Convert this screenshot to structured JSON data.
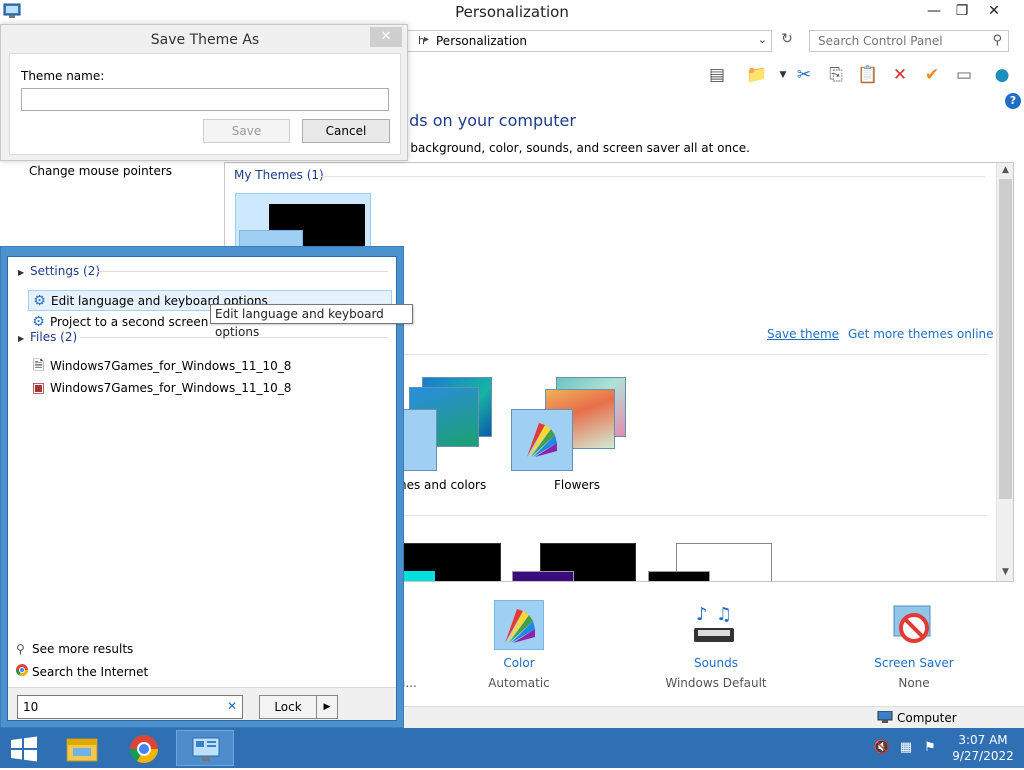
{
  "window": {
    "title": "Personalization",
    "address_path": "Personalization",
    "search_placeholder": "Search Control Panel",
    "heading": "nds on your computer",
    "subheading": "p background, color, sounds, and screen saver all at once.",
    "left_link": "Change mouse pointers"
  },
  "themes": {
    "my_themes_header": "My Themes (1)",
    "save_theme": "Save theme",
    "more_themes": "Get more themes online",
    "lines_label": "nes and colors",
    "flowers_label": "Flowers"
  },
  "bottom": {
    "color_label": "Color",
    "color_value": "Automatic",
    "sounds_label": "Sounds",
    "sounds_value": "Windows Default",
    "saver_label": "Screen Saver",
    "saver_value": "None",
    "desktop_truncated": "a..."
  },
  "status": {
    "computer_label": "Computer"
  },
  "dialog": {
    "title": "Save Theme As",
    "theme_name_label": "Theme name:",
    "theme_name_value": "",
    "save_label": "Save",
    "cancel_label": "Cancel"
  },
  "search_panel": {
    "settings_header": "Settings (2)",
    "results_settings": [
      "Edit language and keyboard options",
      "Project to a second screen"
    ],
    "files_header": "Files (2)",
    "results_files": [
      "Windows7Games_for_Windows_11_10_8",
      "Windows7Games_for_Windows_11_10_8"
    ],
    "tooltip": "Edit language and keyboard options",
    "see_more": "See more results",
    "search_internet": "Search the Internet",
    "query": "10",
    "lock_label": "Lock"
  },
  "taskbar": {
    "time": "3:07 AM",
    "date": "9/27/2022"
  },
  "colors": {
    "taskbar": "#2f6fb4",
    "link": "#1e6ec8",
    "heading": "#1e3b8a",
    "selection": "#cde8ff"
  }
}
